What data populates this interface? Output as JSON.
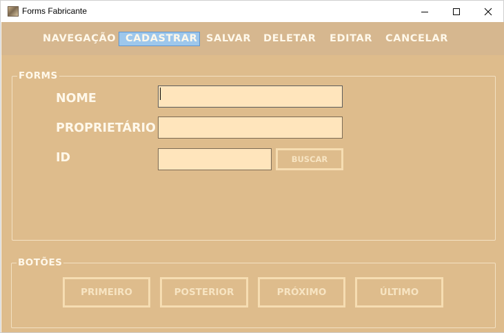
{
  "window": {
    "title": "Forms Fabricante",
    "controls": {
      "minimize": "minimize",
      "maximize": "maximize",
      "close": "close"
    }
  },
  "menu": [
    {
      "label": "NAVEGAÇÃO",
      "active": false
    },
    {
      "label": "CADASTRAR",
      "active": true
    },
    {
      "label": "SALVAR",
      "active": false
    },
    {
      "label": "DELETAR",
      "active": false
    },
    {
      "label": "EDITAR",
      "active": false
    },
    {
      "label": "CANCELAR",
      "active": false
    }
  ],
  "forms_group": {
    "title": "FORMS",
    "fields": {
      "nome": {
        "label": "NOME",
        "value": ""
      },
      "proprietario": {
        "label": "PROPRIETÁRIO",
        "value": ""
      },
      "id": {
        "label": "ID",
        "value": ""
      }
    },
    "buscar_label": "BUSCAR"
  },
  "botoes_group": {
    "title": "BOTÕES",
    "buttons": {
      "primeiro": "PRIMEIRO",
      "posterior": "POSTERIOR",
      "proximo": "PRÓXIMO",
      "ultimo": "ÚLTIMO"
    }
  },
  "colors": {
    "background": "#debc8c",
    "menubar": "#d6b78f",
    "text_light": "#fff8ea",
    "input_fill": "#ffe5bc",
    "active_menu": "#9dc7ec",
    "button_outline": "#f6ddb2"
  }
}
